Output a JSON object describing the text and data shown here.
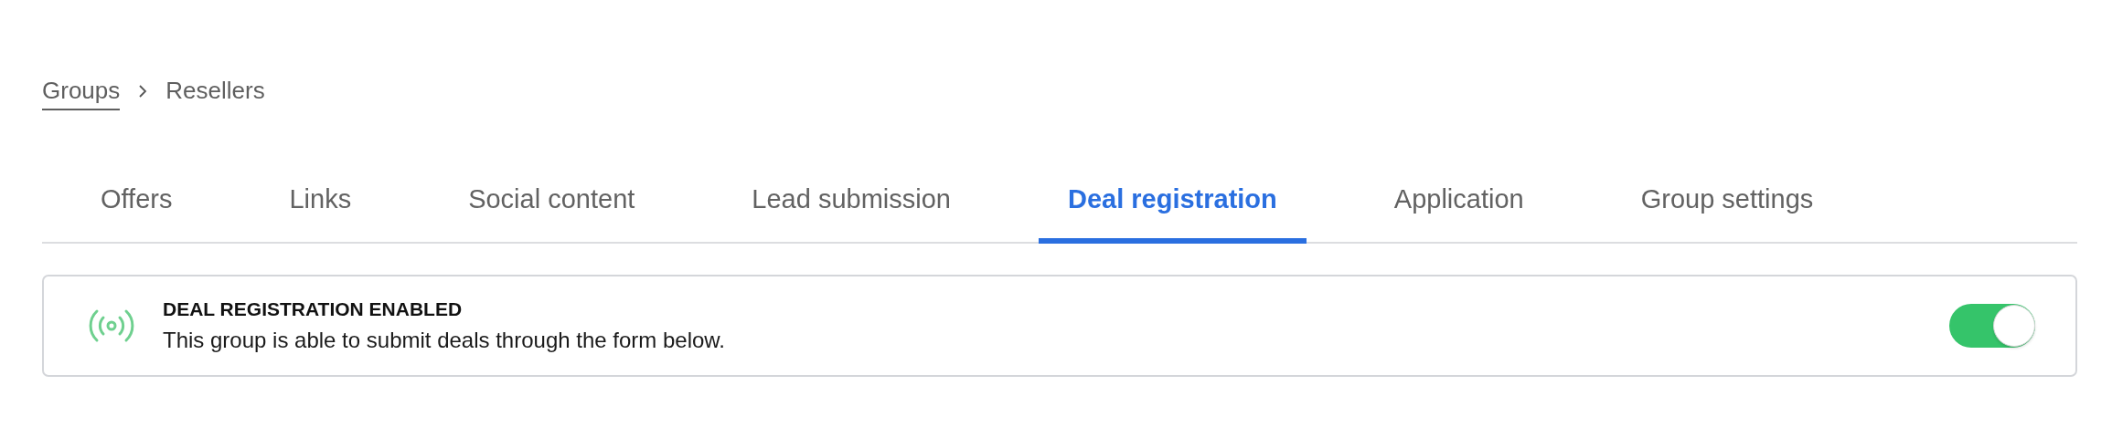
{
  "breadcrumb": [
    {
      "label": "Groups",
      "kind": "link"
    },
    {
      "label": "Resellers",
      "kind": "current"
    }
  ],
  "tabs": [
    {
      "label": "Offers",
      "selected": false
    },
    {
      "label": "Links",
      "selected": false
    },
    {
      "label": "Social content",
      "selected": false
    },
    {
      "label": "Lead submission",
      "selected": false
    },
    {
      "label": "Deal registration",
      "selected": true
    },
    {
      "label": "Application",
      "selected": false
    },
    {
      "label": "Group settings",
      "selected": false
    }
  ],
  "status_card": {
    "title": "DEAL REGISTRATION ENABLED",
    "description": "This group is able to submit deals through the form below.",
    "on": true
  }
}
